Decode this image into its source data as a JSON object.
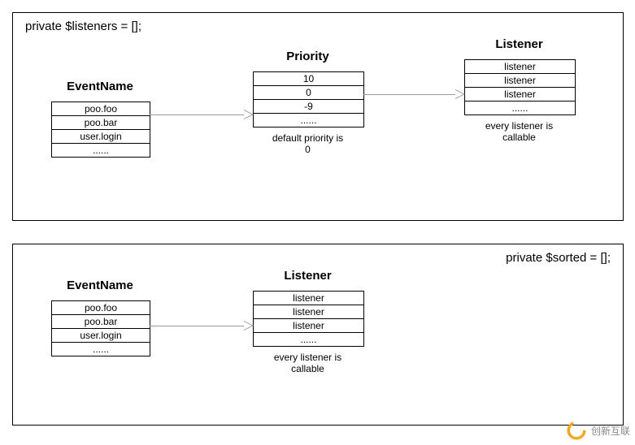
{
  "panel1": {
    "title": "private $listeners = [];",
    "event": {
      "heading": "EventName",
      "rows": [
        "poo.foo",
        "poo.bar",
        "user.login",
        "......"
      ]
    },
    "priority": {
      "heading": "Priority",
      "rows": [
        "10",
        "0",
        "-9",
        "......"
      ],
      "note_l1": "default priority is",
      "note_l2": "0"
    },
    "listener": {
      "heading": "Listener",
      "rows": [
        "listener",
        "listener",
        "listener",
        "......"
      ],
      "note_l1": "every listener is",
      "note_l2": "callable"
    }
  },
  "panel2": {
    "title": "private $sorted = [];",
    "event": {
      "heading": "EventName",
      "rows": [
        "poo.foo",
        "poo.bar",
        "user.login",
        "......"
      ]
    },
    "listener": {
      "heading": "Listener",
      "rows": [
        "listener",
        "listener",
        "listener",
        "......"
      ],
      "note_l1": "every listener is",
      "note_l2": "callable"
    }
  },
  "watermark": "创新互联"
}
